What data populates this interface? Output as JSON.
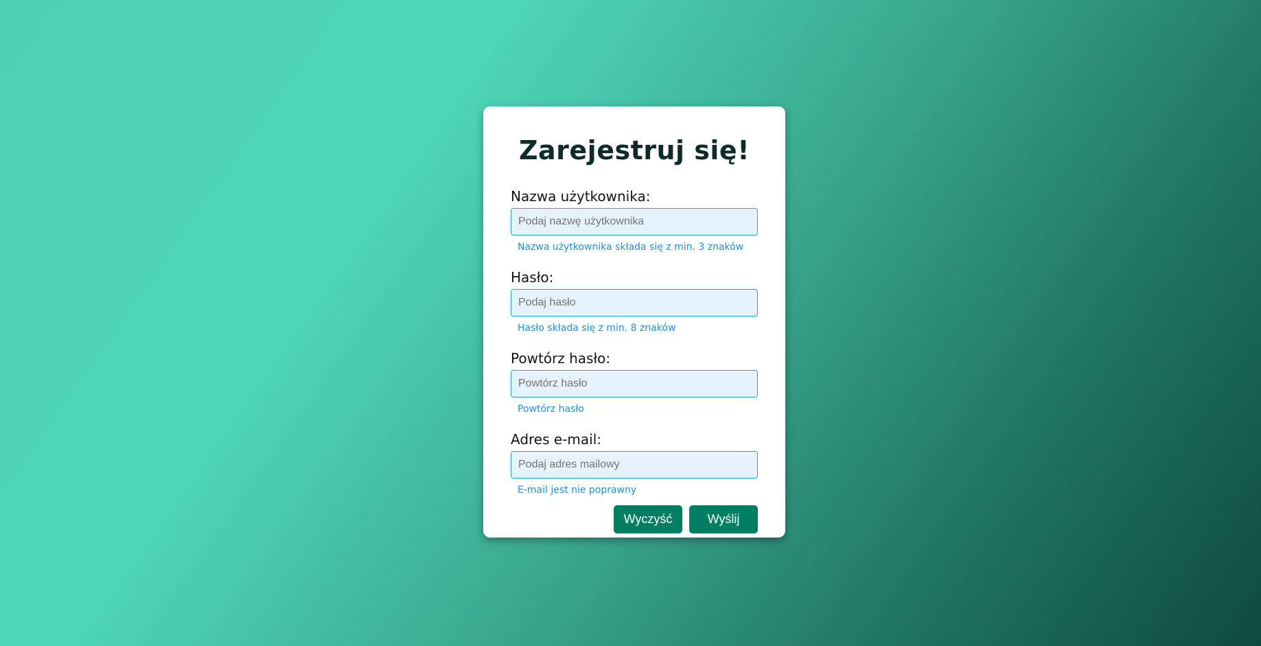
{
  "form": {
    "title": "Zarejestruj się!",
    "fields": [
      {
        "label": "Nazwa użytkownika:",
        "placeholder": "Podaj nazwę użytkownika",
        "value": "",
        "hint": "Nazwa użytkownika składa się z min. 3 znaków"
      },
      {
        "label": "Hasło:",
        "placeholder": "Podaj hasło",
        "value": "",
        "hint": "Hasło składa się z min. 8 znaków"
      },
      {
        "label": "Powtórz hasło:",
        "placeholder": "Powtórz hasło",
        "value": "",
        "hint": "Powtórz hasło"
      },
      {
        "label": "Adres e-mail:",
        "placeholder": "Podaj adres mailowy",
        "value": "",
        "hint": "E-mail jest nie poprawny"
      }
    ],
    "buttons": {
      "clear_label": "Wyczyść",
      "submit_label": "Wyślij"
    }
  },
  "colors": {
    "accent": "#007f62",
    "hint": "#1d8fe0",
    "input_border": "#19a9d8",
    "input_bg": "#e6f3fd",
    "title": "#0f2b28"
  }
}
